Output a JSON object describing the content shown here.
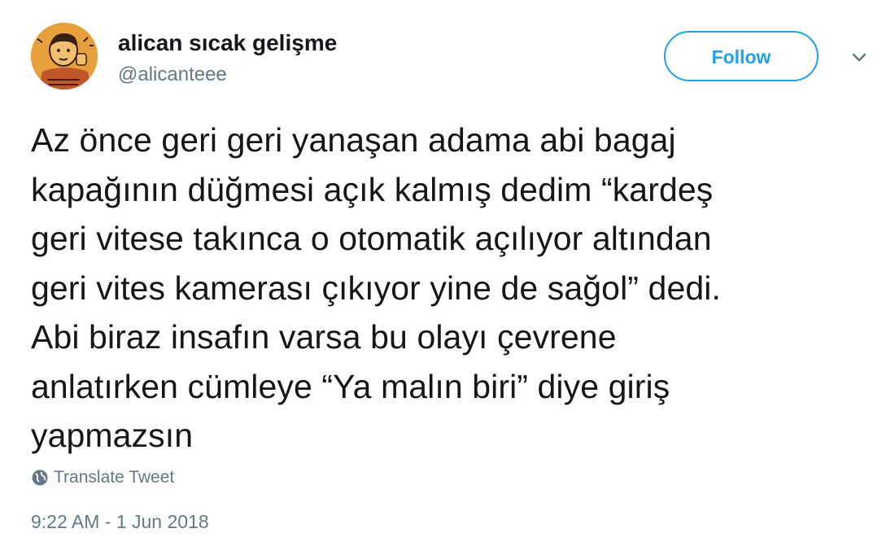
{
  "user": {
    "display_name": "alican sıcak gelişme",
    "handle": "@alicanteee",
    "avatar_icon": "illustrated-face-avatar"
  },
  "actions": {
    "follow_label": "Follow",
    "caret_icon": "chevron-down-icon"
  },
  "tweet": {
    "text": "Az önce geri geri yanaşan adama abi bagaj\nkapağının düğmesi açık kalmış dedim “kardeş\ngeri vitese takınca o otomatik açılıyor altından\ngeri vites kamerası çıkıyor yine de sağol” dedi.\nAbi biraz insafın varsa bu olayı çevrene\nanlatırken cümleye “Ya malın biri” diye giriş\nyapmazsın",
    "translate_label": "Translate Tweet",
    "translate_icon": "globe-icon",
    "timestamp": "9:22 AM - 1 Jun 2018"
  },
  "colors": {
    "accent": "#1da1f2",
    "text": "#14171a",
    "muted": "#657786"
  }
}
